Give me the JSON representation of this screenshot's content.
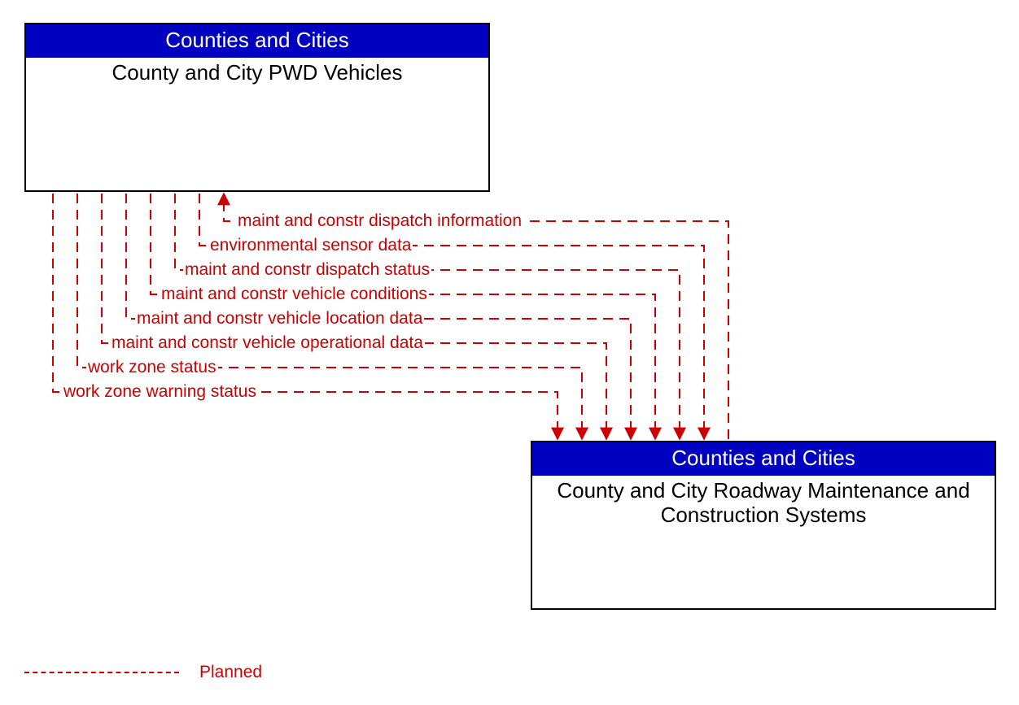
{
  "diagram": {
    "boxes": {
      "top": {
        "header": "Counties and Cities",
        "body": "County and City PWD Vehicles"
      },
      "bottom": {
        "header": "Counties and Cities",
        "body": "County and City Roadway Maintenance and Construction Systems"
      }
    },
    "flows": {
      "f1": "maint and constr dispatch information",
      "f2": "environmental sensor data",
      "f3": "maint and constr dispatch status",
      "f4": "maint and constr vehicle conditions",
      "f5": "maint and constr vehicle location data",
      "f6": "maint and constr vehicle operational data",
      "f7": "work zone status",
      "f8": "work zone warning status"
    },
    "legend": {
      "planned": "Planned"
    }
  },
  "chart_data": {
    "type": "diagram",
    "nodes": [
      {
        "id": "top",
        "stakeholder": "Counties and Cities",
        "name": "County and City PWD Vehicles"
      },
      {
        "id": "bottom",
        "stakeholder": "Counties and Cities",
        "name": "County and City Roadway Maintenance and Construction Systems"
      }
    ],
    "edges": [
      {
        "from": "bottom",
        "to": "top",
        "label": "maint and constr dispatch information",
        "status": "planned"
      },
      {
        "from": "top",
        "to": "bottom",
        "label": "environmental sensor data",
        "status": "planned"
      },
      {
        "from": "top",
        "to": "bottom",
        "label": "maint and constr dispatch status",
        "status": "planned"
      },
      {
        "from": "top",
        "to": "bottom",
        "label": "maint and constr vehicle conditions",
        "status": "planned"
      },
      {
        "from": "top",
        "to": "bottom",
        "label": "maint and constr vehicle location data",
        "status": "planned"
      },
      {
        "from": "top",
        "to": "bottom",
        "label": "maint and constr vehicle operational data",
        "status": "planned"
      },
      {
        "from": "top",
        "to": "bottom",
        "label": "work zone status",
        "status": "planned"
      },
      {
        "from": "top",
        "to": "bottom",
        "label": "work zone warning status",
        "status": "planned"
      }
    ],
    "legend": {
      "planned": "Planned (dashed red)"
    }
  }
}
